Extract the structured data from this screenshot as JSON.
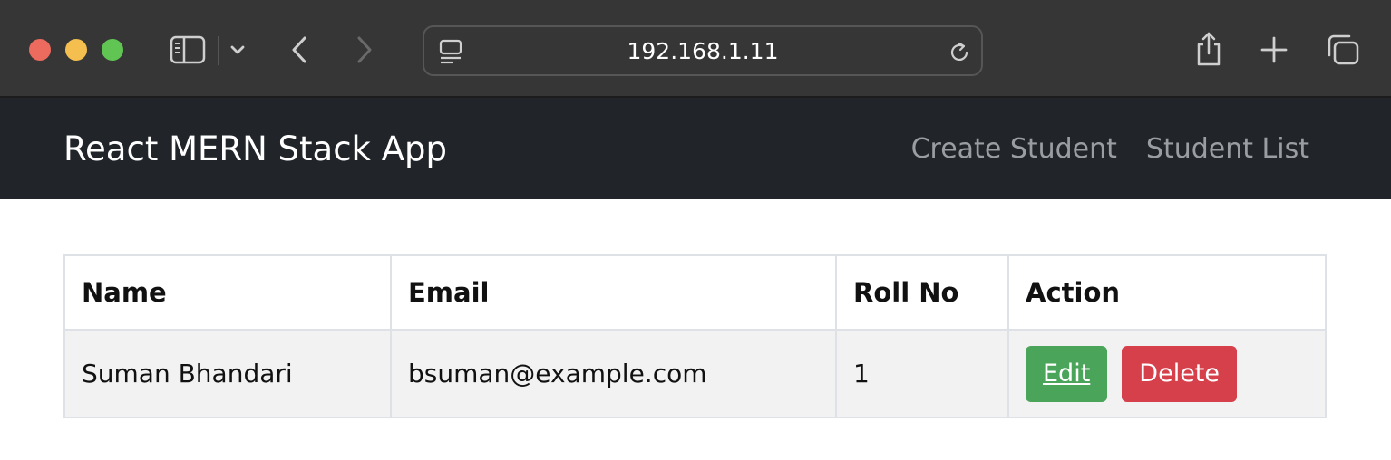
{
  "browser": {
    "address": "192.168.1.11",
    "icons": [
      "sidebar-icon",
      "chevron-down-icon",
      "back-icon",
      "forward-icon",
      "page-menu-icon",
      "reload-icon",
      "share-icon",
      "new-tab-icon",
      "tab-overview-icon"
    ]
  },
  "navbar": {
    "brand": "React MERN Stack App",
    "links": [
      "Create Student",
      "Student List"
    ]
  },
  "table": {
    "headers": [
      "Name",
      "Email",
      "Roll No",
      "Action"
    ],
    "rows": [
      {
        "name": "Suman Bhandari",
        "email": "bsuman@example.com",
        "roll_no": "1",
        "edit_label": "Edit",
        "delete_label": "Delete"
      }
    ]
  },
  "colors": {
    "chrome_bg": "#363636",
    "navbar_bg": "#212529",
    "edit_button": "#4aa55a",
    "delete_button": "#d6404b",
    "row_bg": "#f2f2f2"
  }
}
